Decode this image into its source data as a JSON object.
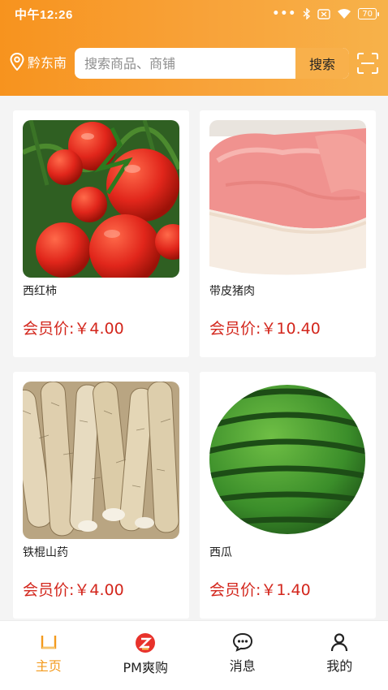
{
  "status_bar": {
    "time": "中午12:26",
    "battery": "70"
  },
  "header": {
    "location": "黔东南",
    "search_placeholder": "搜索商品、商铺",
    "search_button": "搜索"
  },
  "products": [
    {
      "name": "西红柿",
      "price": "会员价:￥4.00",
      "image_icon": "tomato-image"
    },
    {
      "name": "带皮猪肉",
      "price": "会员价:￥10.40",
      "image_icon": "pork-image"
    },
    {
      "name": "铁棍山药",
      "price": "会员价:￥4.00",
      "image_icon": "yam-image"
    },
    {
      "name": "西瓜",
      "price": "会员价:￥1.40",
      "image_icon": "watermelon-image"
    }
  ],
  "tabbar": {
    "items": [
      {
        "label": "主页",
        "icon": "home-icon",
        "active": true
      },
      {
        "label": "PM爽购",
        "icon": "pm-logo-icon",
        "active": false
      },
      {
        "label": "消息",
        "icon": "message-icon",
        "active": false
      },
      {
        "label": "我的",
        "icon": "profile-icon",
        "active": false
      }
    ]
  },
  "colors": {
    "accent": "#f7931e",
    "price": "#d3261c",
    "tab_active": "#f39a1d"
  }
}
